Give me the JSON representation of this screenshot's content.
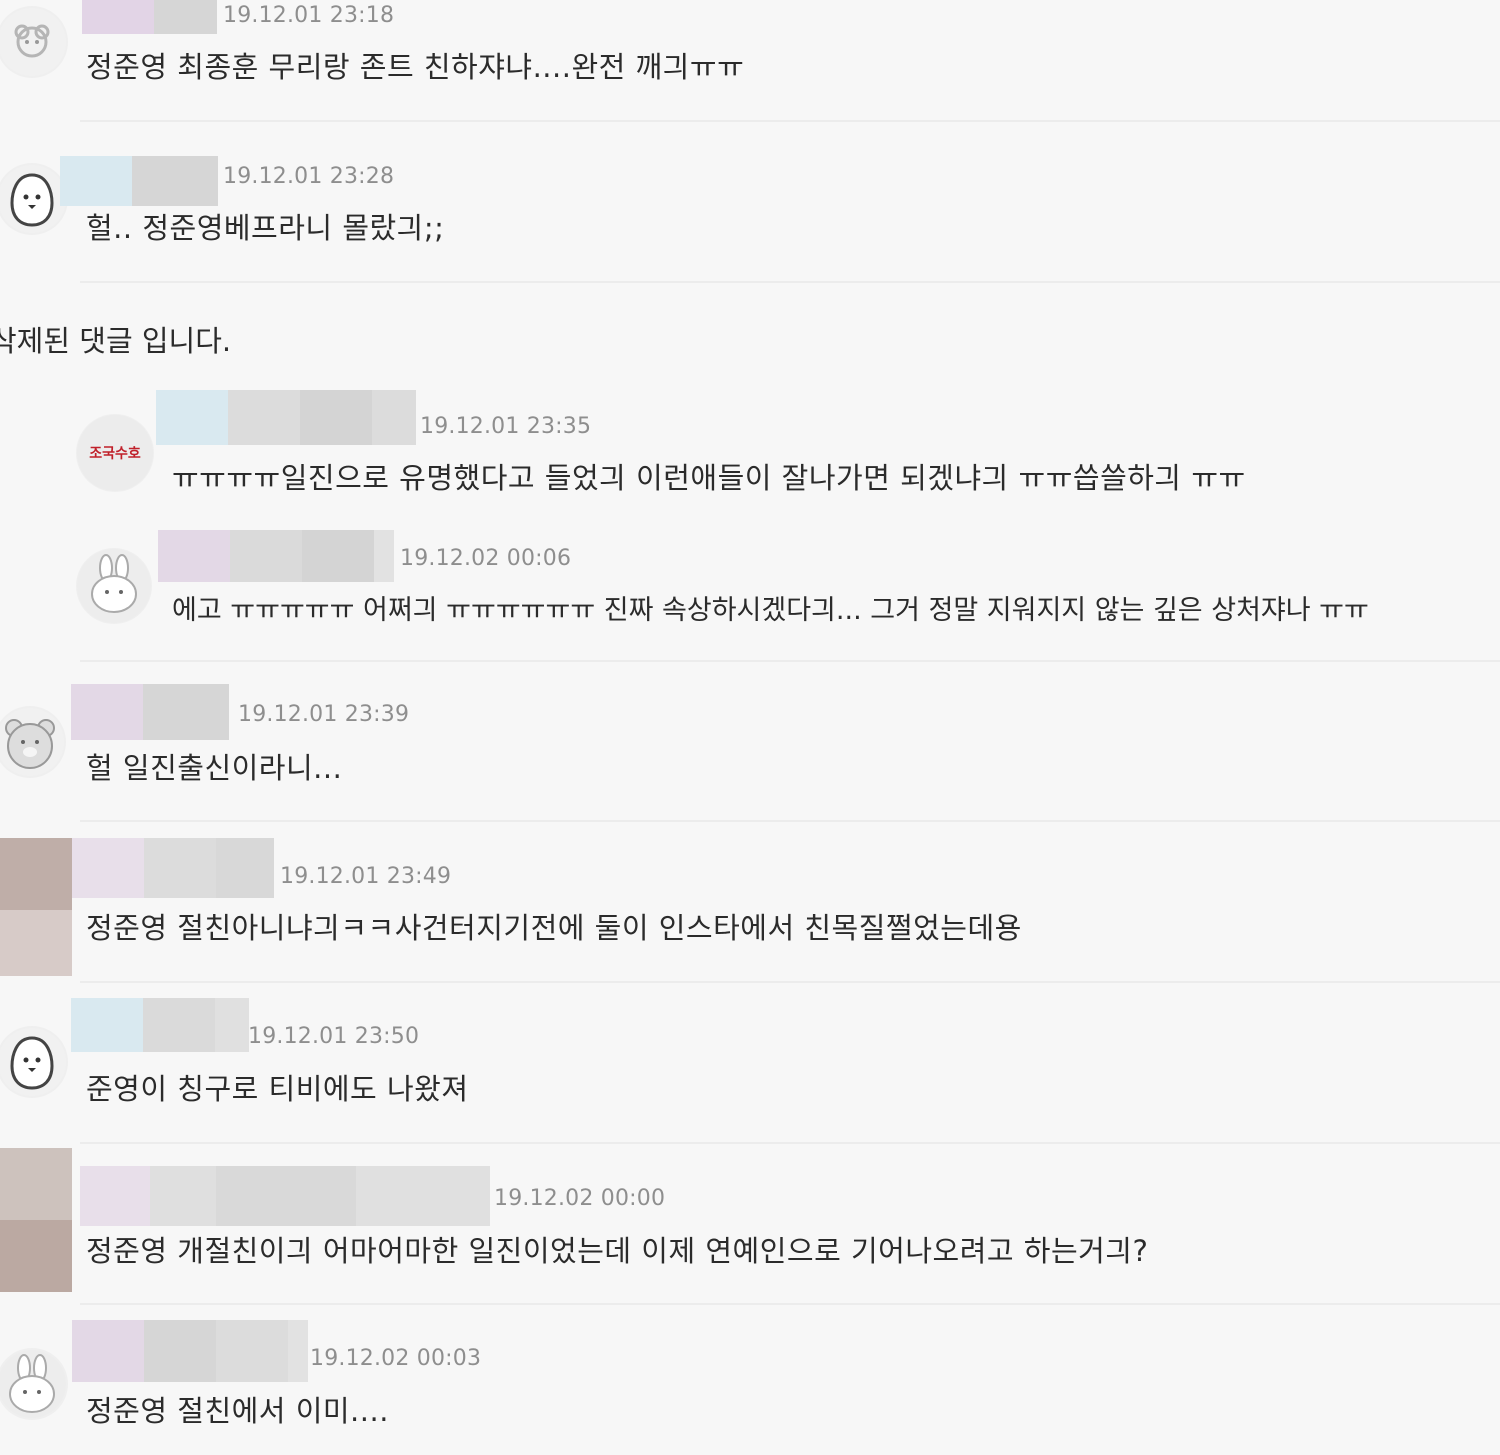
{
  "comments": [
    {
      "date": "19.12.01 23:18",
      "text": "정준영 최종훈 무리랑 존트 친하쟈냐....완전 깨긔ㅠㅠ"
    },
    {
      "date": "19.12.01 23:28",
      "text": "헐.. 정준영베프라니 몰랐긔;;"
    },
    {
      "deleted": "삭제된 댓글 입니다."
    },
    {
      "badge": "조국수호",
      "date": "19.12.01 23:35",
      "text": "ㅠㅠㅠㅠ일진으로 유명했다고 들었긔 이런애들이 잘나가면 되겠냐긔 ㅠㅠ씁쓸하긔 ㅠㅠ"
    },
    {
      "date": "19.12.02 00:06",
      "text": "에고 ㅠㅠㅠㅠㅠ 어쩌긔 ㅠㅠㅠㅠㅠㅠ 진짜 속상하시겠다긔... 그거 정말 지워지지 않는 깊은 상처쟈나 ㅠㅠ"
    },
    {
      "date": "19.12.01 23:39",
      "text": "헐 일진출신이라니..."
    },
    {
      "date": "19.12.01 23:49",
      "text": "정준영 절친아니냐긔ㅋㅋ사건터지기전에 둘이 인스타에서 친목질쩔었는데용"
    },
    {
      "date": "19.12.01 23:50",
      "text": "준영이 칭구로 티비에도 나왔져"
    },
    {
      "date": "19.12.02 00:00",
      "text": "정준영 개절친이긔 어마어마한 일진이었는데 이제 연예인으로 기어나오려고 하는거긔?"
    },
    {
      "date": "19.12.02 00:03",
      "text": "정준영 절친에서 이미...."
    }
  ],
  "colors": {
    "background": "#f7f7f7",
    "date_text": "#8e8e8e",
    "divider": "#ececec",
    "blur_pink": "#e3d8e6",
    "blur_blue": "#d9e9f0",
    "blur_gray": "#d8d8d8",
    "avatar_brown": "#bfaea6"
  },
  "icons": [
    "sheep-avatar-icon",
    "penguin-avatar-icon",
    "badge-avatar-icon",
    "rabbit-avatar-icon",
    "bear-avatar-icon",
    "square-photo-avatar",
    "penguin-avatar-icon",
    "square-photo-avatar",
    "rabbit-avatar-icon"
  ]
}
